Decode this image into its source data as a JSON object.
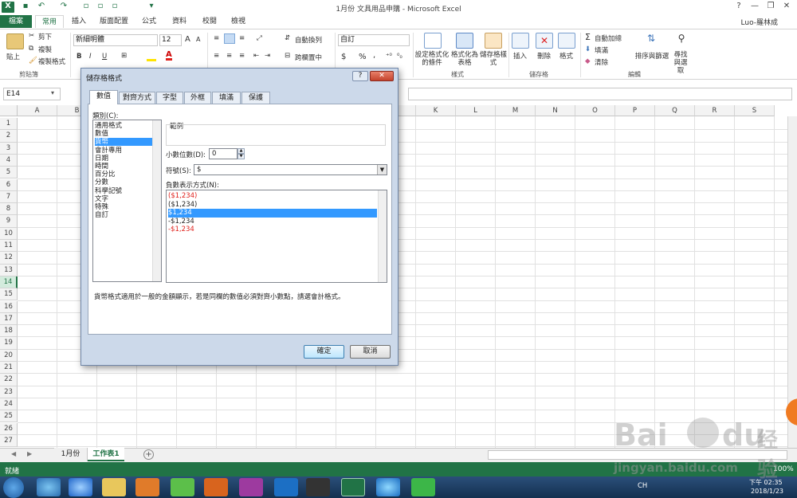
{
  "app": {
    "title": "1月份 文具用品申購 - Microsoft Excel",
    "user": "Luo-羅林成",
    "window_controls": [
      "?",
      "—",
      "❐",
      "✕"
    ]
  },
  "ribbon_tabs": [
    "檔案",
    "常用",
    "插入",
    "版面配置",
    "公式",
    "資料",
    "校閱",
    "檢視"
  ],
  "ribbon": {
    "clipboard": {
      "paste": "貼上",
      "cut": "剪下",
      "copy": "複製",
      "format_painter": "複製格式",
      "label": "剪貼簿"
    },
    "font": {
      "name": "新細明體",
      "size": "12",
      "bold": "B",
      "italic": "I",
      "underline": "U",
      "grow": "A",
      "shrink": "A"
    },
    "alignment": {
      "wrap": "自動換列",
      "merge": "跨欄置中"
    },
    "number": {
      "format": "自訂",
      "currency": "$",
      "percent": "%",
      "comma": ","
    },
    "styles": {
      "conditional": "設定格式化的條件",
      "table": "格式化為表格",
      "cell": "儲存格樣式",
      "label": "樣式"
    },
    "cells": {
      "insert": "插入",
      "delete": "刪除",
      "format": "格式",
      "label": "儲存格"
    },
    "editing": {
      "autosum": "自動加總",
      "fill": "填滿",
      "clear": "清除",
      "sort": "排序與篩選",
      "find": "尋找與選取",
      "label": "編輯"
    }
  },
  "formula_bar": {
    "name_box": "E14"
  },
  "columns": [
    "A",
    "B",
    "C",
    "D",
    "E",
    "F",
    "G",
    "H",
    "I",
    "J",
    "K",
    "L",
    "M",
    "N",
    "O",
    "P",
    "Q",
    "R",
    "S"
  ],
  "rows": [
    "1",
    "2",
    "3",
    "4",
    "5",
    "6",
    "7",
    "8",
    "9",
    "10",
    "11",
    "12",
    "13",
    "14",
    "15",
    "16",
    "17",
    "18",
    "19",
    "20",
    "21",
    "22",
    "23",
    "24",
    "25",
    "26",
    "27"
  ],
  "selected_row": "14",
  "sheets": [
    {
      "name": "1月份",
      "active": false
    },
    {
      "name": "工作表1",
      "active": true
    }
  ],
  "status": {
    "left": "就緒",
    "zoom": "100%"
  },
  "dialog": {
    "title": "儲存格格式",
    "help": "?",
    "close": "✕",
    "tabs": [
      "數值",
      "對齊方式",
      "字型",
      "外框",
      "填滿",
      "保護"
    ],
    "active_tab": "數值",
    "category_label": "類別(C):",
    "categories": [
      "通用格式",
      "數值",
      "貨幣",
      "會計專用",
      "日期",
      "時間",
      "百分比",
      "分數",
      "科學記號",
      "文字",
      "特殊",
      "自訂"
    ],
    "selected_category": "貨幣",
    "sample_label": "範例",
    "decimal_label": "小數位數(D):",
    "decimal_value": "0",
    "symbol_label": "符號(S):",
    "symbol_value": "$",
    "negative_label": "負數表示方式(N):",
    "negatives": [
      {
        "text": "($1,234)",
        "red": true,
        "selected": false
      },
      {
        "text": "($1,234)",
        "red": false,
        "selected": false
      },
      {
        "text": "$1,234",
        "red": false,
        "selected": true
      },
      {
        "text": "-$1,234",
        "red": false,
        "selected": false
      },
      {
        "text": "-$1,234",
        "red": true,
        "selected": false
      }
    ],
    "description": "貨幣格式適用於一般的金額顯示，若是同欄的數值必須對齊小數點，請選會計格式。",
    "ok": "確定",
    "cancel": "取消"
  },
  "taskbar": {
    "lang": "CH",
    "time": "下午 02:35",
    "date": "2018/1/23"
  },
  "watermark": {
    "brand": "Bai",
    "du": "du",
    "chinese": "经验",
    "url": "jingyan.baidu.com"
  },
  "colors": {
    "excel_green": "#217346",
    "selection_blue": "#3399ff",
    "negative_red": "#e0201b"
  }
}
